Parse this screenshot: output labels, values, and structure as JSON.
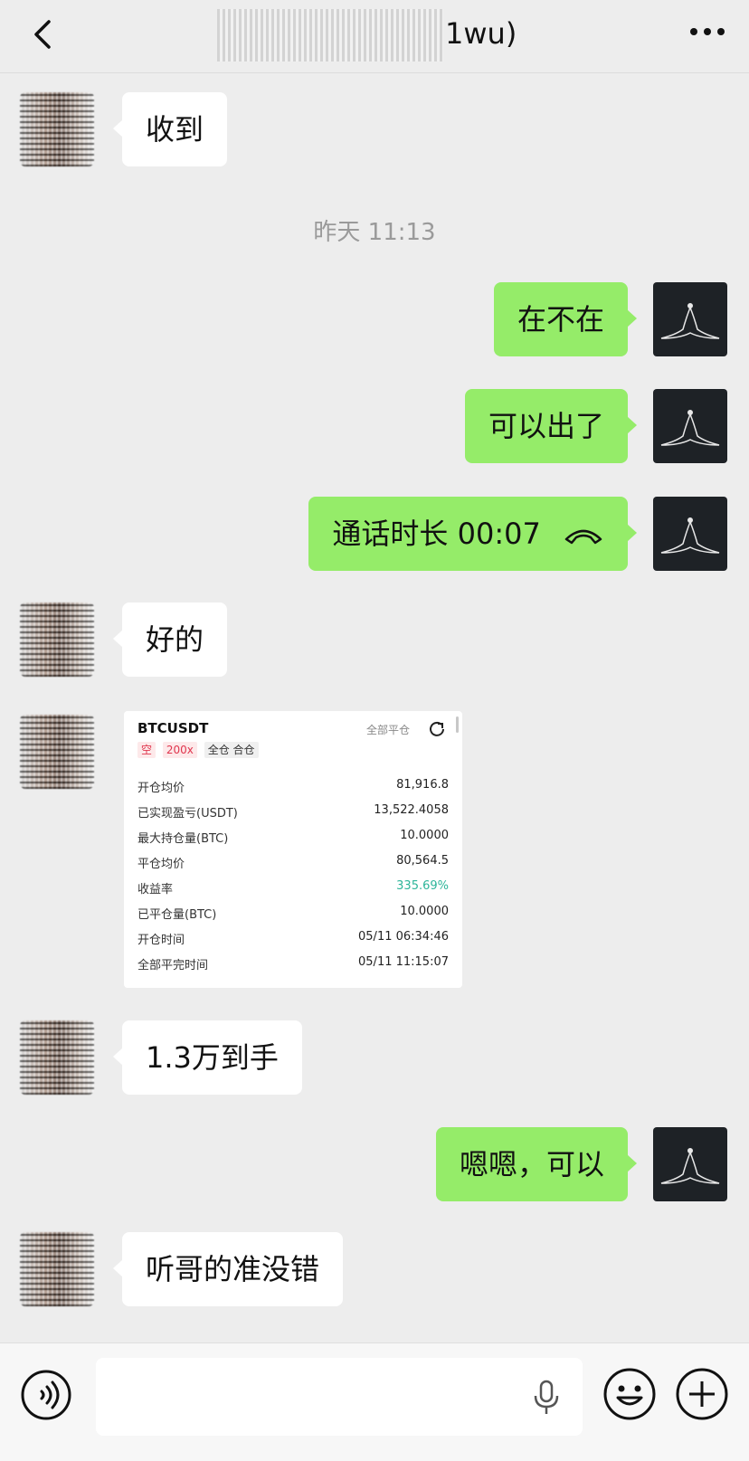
{
  "header": {
    "title_suffix": "1wu)",
    "back_icon": "chevron-left-icon",
    "more_icon": "more-dots-icon"
  },
  "timestamp": "昨天 11:13",
  "messages": {
    "m1": "收到",
    "m2": "在不在",
    "m3": "可以出了",
    "m4": "通话时长 00:07",
    "m5": "好的",
    "m6": "1.3万到手",
    "m7": "嗯嗯，可以",
    "m8": "听哥的准没错"
  },
  "trade_card": {
    "symbol": "BTCUSDT",
    "close_all": "全部平仓",
    "tag_side": "空",
    "tag_leverage": "200x",
    "tag_mode": "全仓 合仓",
    "rows": [
      {
        "k": "开仓均价",
        "v": "81,916.8"
      },
      {
        "k": "已实现盈亏(USDT)",
        "v": "13,522.4058"
      },
      {
        "k": "最大持仓量(BTC)",
        "v": "10.0000"
      },
      {
        "k": "平仓均价",
        "v": "80,564.5"
      },
      {
        "k": "收益率",
        "v": "335.69%"
      },
      {
        "k": "已平仓量(BTC)",
        "v": "10.0000"
      },
      {
        "k": "开仓时间",
        "v": "05/11 06:34:46"
      },
      {
        "k": "全部平完时间",
        "v": "05/11 11:15:07"
      }
    ],
    "profit_color": "#2eb59a"
  },
  "colors": {
    "self_bubble": "#95ec69",
    "other_bubble": "#ffffff",
    "background": "#ededed"
  },
  "input": {
    "placeholder": ""
  }
}
